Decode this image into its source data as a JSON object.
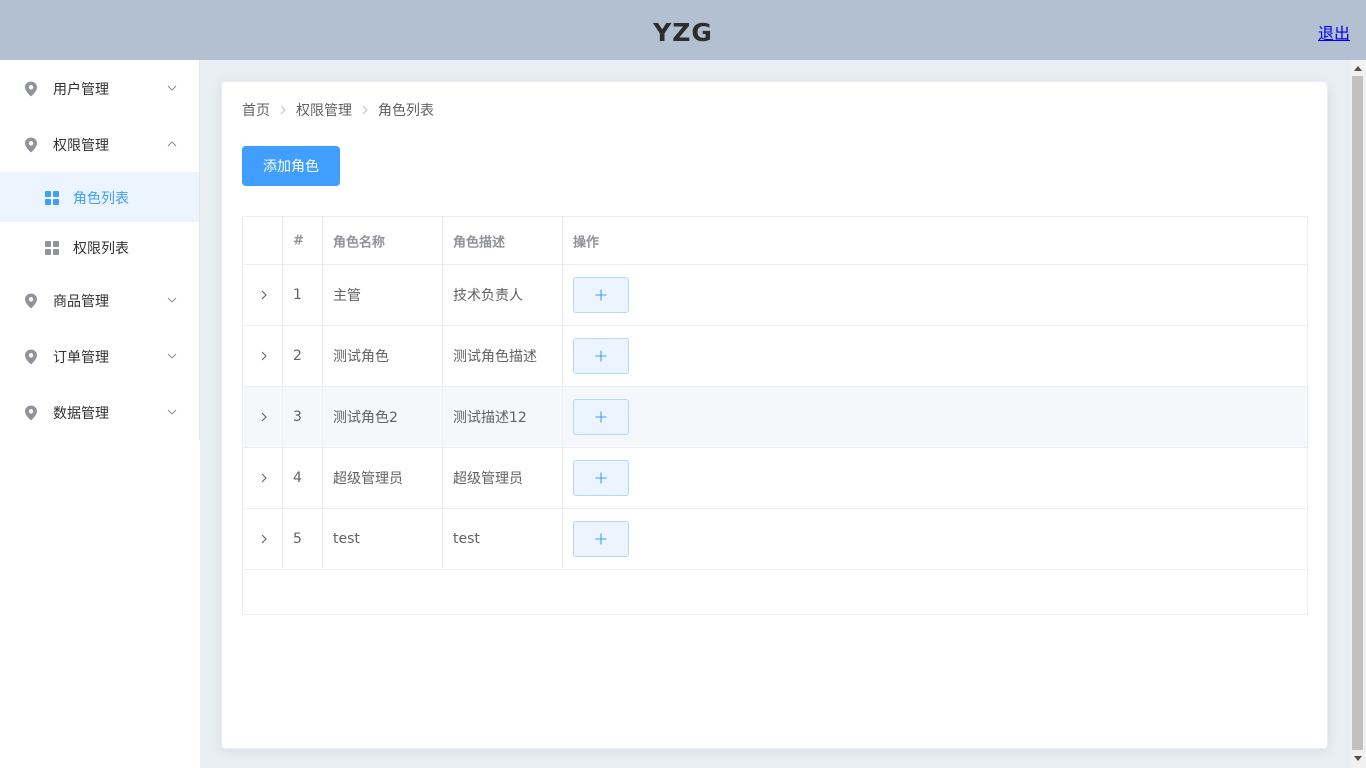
{
  "header": {
    "title": "YZG",
    "logout": "退出"
  },
  "sidebar": {
    "menus": [
      {
        "label": "用户管理"
      },
      {
        "label": "权限管理"
      },
      {
        "label": "商品管理"
      },
      {
        "label": "订单管理"
      },
      {
        "label": "数据管理"
      }
    ],
    "submenus": [
      {
        "label": "角色列表",
        "active": true
      },
      {
        "label": "权限列表",
        "active": false
      }
    ]
  },
  "breadcrumb": [
    "首页",
    "权限管理",
    "角色列表"
  ],
  "toolbar": {
    "add_label": "添加角色"
  },
  "table": {
    "headers": {
      "index": "#",
      "name": "角色名称",
      "desc": "角色描述",
      "ops": "操作"
    },
    "rows": [
      {
        "index": "1",
        "name": "主管",
        "desc": "技术负责人"
      },
      {
        "index": "2",
        "name": "测试角色",
        "desc": "测试角色描述"
      },
      {
        "index": "3",
        "name": "测试角色2",
        "desc": "测试描述12"
      },
      {
        "index": "4",
        "name": "超级管理员",
        "desc": "超级管理员"
      },
      {
        "index": "5",
        "name": "test",
        "desc": "test"
      }
    ]
  },
  "colors": {
    "primary": "#409eff",
    "header_bg": "#b3c0d1",
    "active_bg": "#ecf5ff"
  }
}
